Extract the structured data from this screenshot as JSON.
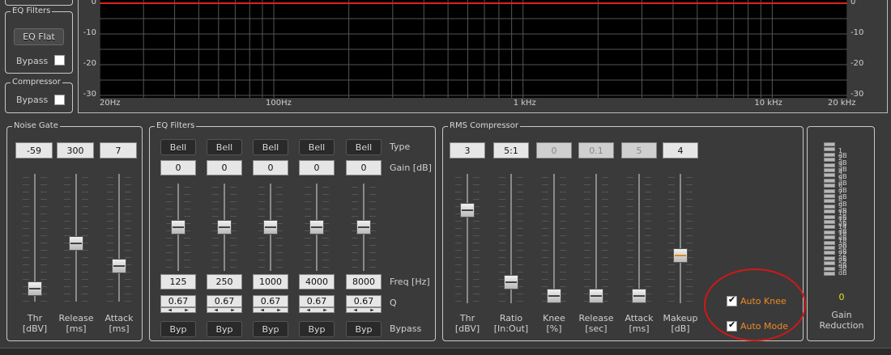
{
  "graph": {
    "left_db_labels": [
      "0",
      "-10",
      "-20",
      "-30"
    ],
    "right_db_labels": [
      "0",
      "-10",
      "-20",
      "-30"
    ],
    "freq_labels": [
      "20Hz",
      "100Hz",
      "1 kHz",
      "10 kHz",
      "20 kHz"
    ],
    "curve_color": "#e02020"
  },
  "sidebar": {
    "eq_filters": {
      "title": "EQ Filters",
      "eq_flat_label": "EQ Flat",
      "bypass_label": "Bypass"
    },
    "compressor": {
      "title": "Compressor",
      "bypass_label": "Bypass"
    }
  },
  "noise_gate": {
    "title": "Noise Gate",
    "values": [
      "-59",
      "300",
      "7"
    ],
    "labels": [
      {
        "l1": "Thr",
        "l2": "[dBV]"
      },
      {
        "l1": "Release",
        "l2": "[ms]"
      },
      {
        "l1": "Attack",
        "l2": "[ms]"
      }
    ],
    "levels": [
      0.05,
      0.45,
      0.25
    ]
  },
  "eq_filters": {
    "title": "EQ Filters",
    "types": [
      "Bell",
      "Bell",
      "Bell",
      "Bell",
      "Bell"
    ],
    "gains": [
      "0",
      "0",
      "0",
      "0",
      "0"
    ],
    "freqs": [
      "125",
      "250",
      "1000",
      "4000",
      "8000"
    ],
    "qs": [
      "0.67",
      "0.67",
      "0.67",
      "0.67",
      "0.67"
    ],
    "byp_labels": [
      "Byp",
      "Byp",
      "Byp",
      "Byp",
      "Byp"
    ],
    "row_labels": {
      "type": "Type",
      "gain": "Gain [dB]",
      "freq": "Freq [Hz]",
      "q": "Q",
      "bypass": "Bypass"
    },
    "levels": [
      0.5,
      0.5,
      0.5,
      0.5,
      0.5
    ]
  },
  "compressor": {
    "title": "RMS Compressor",
    "values": [
      "3",
      "5:1",
      "0",
      "0.1",
      "5",
      "4"
    ],
    "dimmed": [
      false,
      false,
      true,
      true,
      true,
      false
    ],
    "labels": [
      {
        "l1": "Thr",
        "l2": "[dBV]"
      },
      {
        "l1": "Ratio",
        "l2": "[In:Out]"
      },
      {
        "l1": "Knee",
        "l2": "[%]"
      },
      {
        "l1": "Release",
        "l2": "[sec]"
      },
      {
        "l1": "Attack",
        "l2": "[ms]"
      },
      {
        "l1": "Makeup",
        "l2": "[dB]"
      }
    ],
    "levels": [
      0.75,
      0.12,
      0.0,
      0.0,
      0.0,
      0.35
    ],
    "auto_knee_label": "Auto Knee",
    "auto_mode_label": "Auto Mode",
    "auto_knee_checked": true,
    "auto_mode_checked": true,
    "annotation_color": "#d01818"
  },
  "gain_reduction": {
    "value": "0",
    "label_l1": "Gain",
    "label_l2": "Reduction",
    "scale": [
      "1 dB",
      "2 dB",
      "3 dB",
      "4 dB",
      "5 dB",
      "6 dB",
      "7 dB",
      "8 dB",
      "9 dB",
      "10 dB",
      "12 dB",
      "14 dB",
      "16 dB",
      "18 dB",
      "20 dB",
      "22 dB",
      "25 dB",
      "30 dB"
    ],
    "value_color": "#e8e020"
  }
}
